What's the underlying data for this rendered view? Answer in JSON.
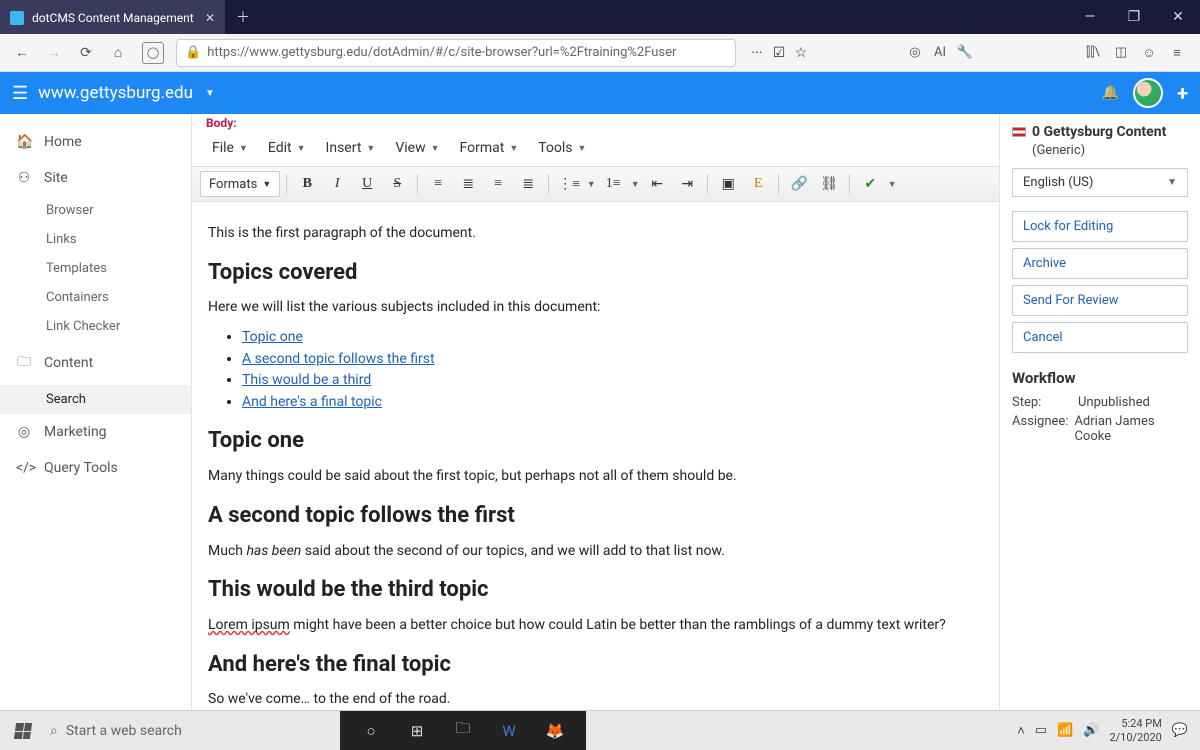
{
  "browser": {
    "tab_title": "dotCMS Content Management",
    "url": "https://www.gettysburg.edu/dotAdmin/#/c/site-browser?url=%2Ftraining%2Fuser",
    "ai_label": "AI"
  },
  "topbar": {
    "site": "www.gettysburg.edu"
  },
  "sidebar": {
    "home": "Home",
    "site": "Site",
    "site_items": [
      "Browser",
      "Links",
      "Templates",
      "Containers",
      "Link Checker"
    ],
    "content": "Content",
    "content_items": [
      "Search"
    ],
    "marketing": "Marketing",
    "query": "Query Tools"
  },
  "editor": {
    "body_label": "Body:",
    "menus": [
      "File",
      "Edit",
      "Insert",
      "View",
      "Format",
      "Tools"
    ],
    "formats_btn": "Formats",
    "content": {
      "p1": "This is the first paragraph of the document.",
      "h1": "Topics covered",
      "p2": "Here we will list the various subjects included in this document:",
      "links": [
        "Topic one",
        "A second topic follows the first",
        "This would be a third",
        "And here's a final topic"
      ],
      "h2": "Topic one",
      "p3": "Many things could be said about the first topic, but perhaps not all of them should be.",
      "h3": "A second topic follows the first",
      "p4_a": "Much ",
      "p4_b": "has been",
      "p4_c": " said about the second of our topics, and we will add to that list now.",
      "h4": "This would be the third topic",
      "p5_a": "Lorem ipsum",
      "p5_b": " might have been a better choice but how could Latin be better than the ramblings of a dummy text writer?",
      "h5": "And here's the final topic",
      "p6": "So we've come… to the end of the road."
    }
  },
  "rightpanel": {
    "title": "0 Gettysburg Content",
    "subtitle": "(Generic)",
    "language": "English (US)",
    "actions": [
      "Lock for Editing",
      "Archive",
      "Send For Review",
      "Cancel"
    ],
    "workflow_head": "Workflow",
    "step_label": "Step:",
    "step_value": "Unpublished",
    "assignee_label": "Assignee:",
    "assignee_value": "Adrian James Cooke"
  },
  "taskbar": {
    "search_placeholder": "Start a web search",
    "time": "5:24 PM",
    "date": "2/10/2020"
  }
}
